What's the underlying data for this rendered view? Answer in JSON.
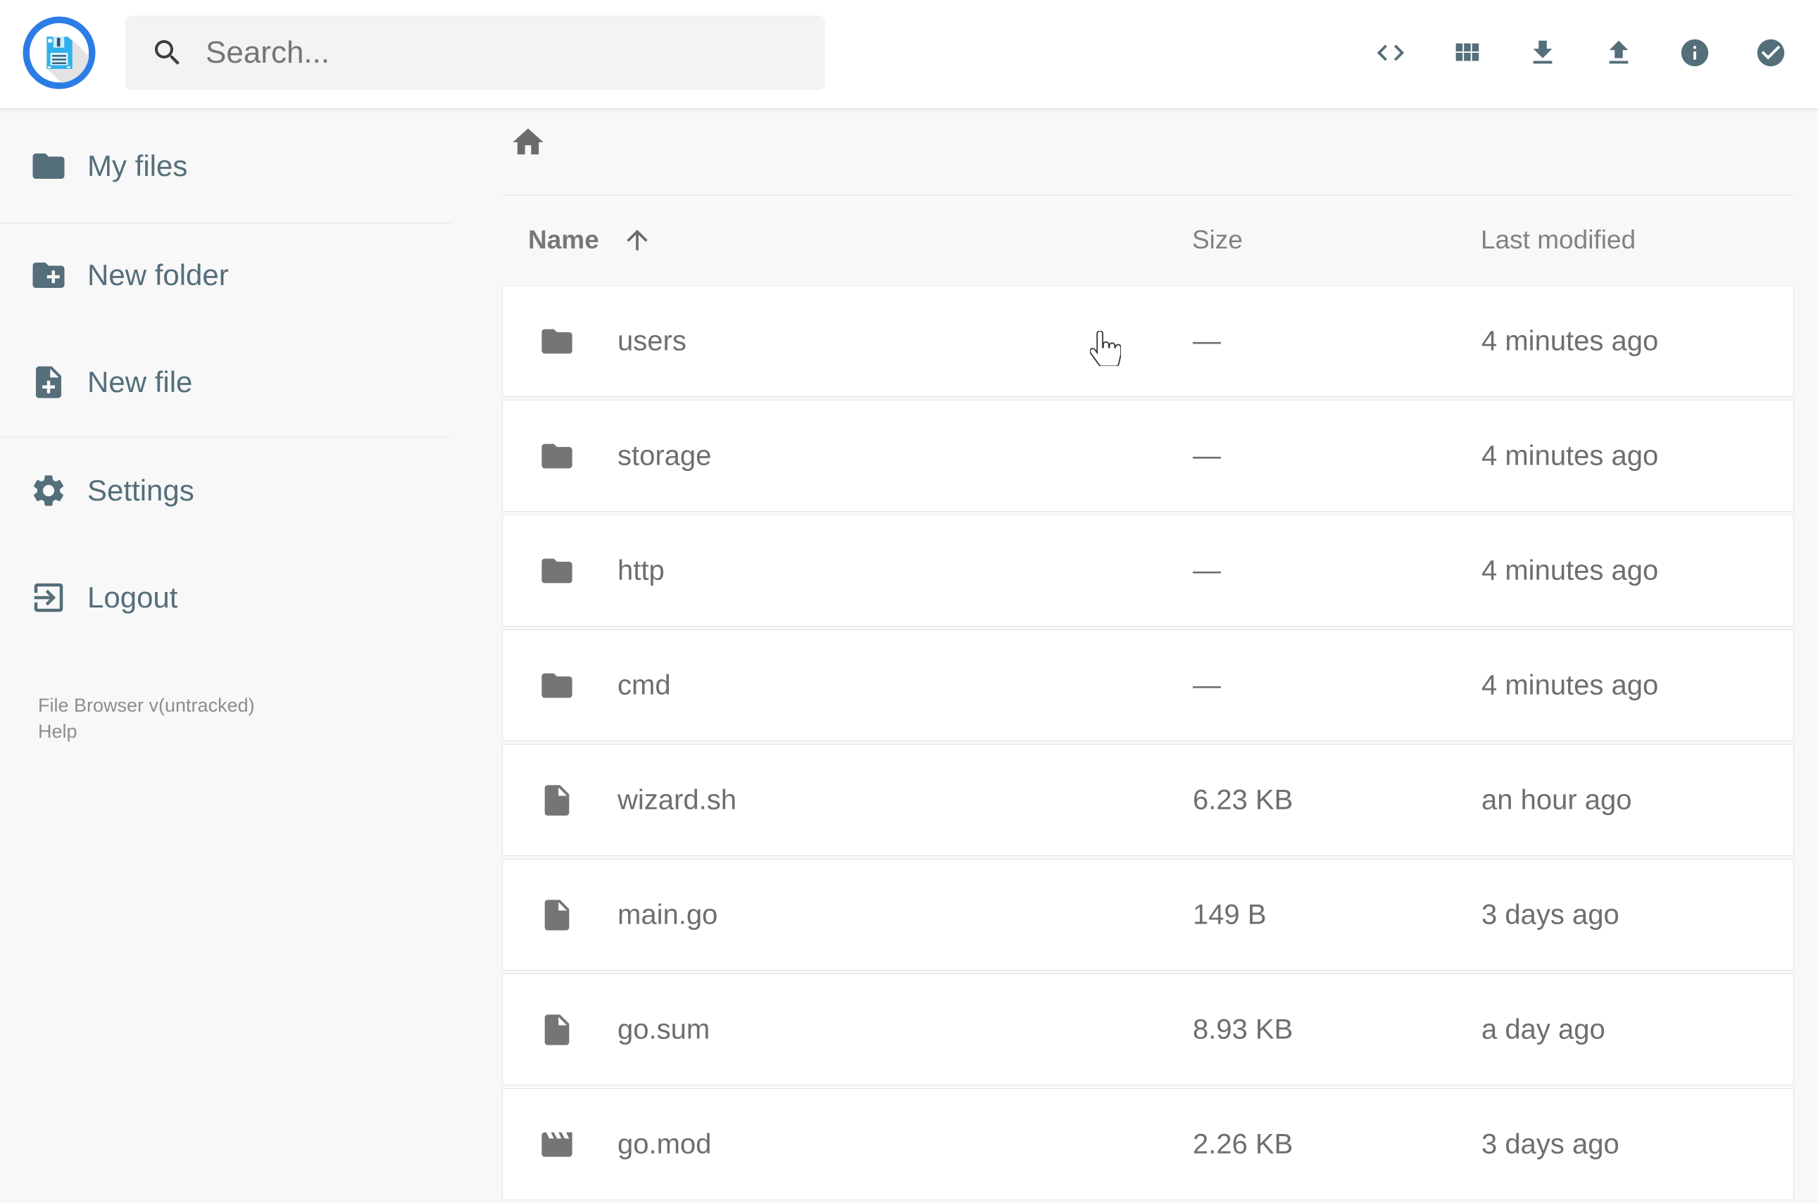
{
  "header": {
    "logo_title": "File Browser",
    "search": {
      "placeholder": "Search..."
    },
    "actions": [
      {
        "name": "open-shell"
      },
      {
        "name": "switch-view"
      },
      {
        "name": "download"
      },
      {
        "name": "upload"
      },
      {
        "name": "info"
      },
      {
        "name": "select-multiple"
      }
    ]
  },
  "sidebar": {
    "items": [
      {
        "label": "My files"
      },
      {
        "label": "New folder"
      },
      {
        "label": "New file"
      },
      {
        "label": "Settings"
      },
      {
        "label": "Logout"
      }
    ],
    "footer": {
      "version": "File Browser v(untracked)",
      "help": "Help"
    }
  },
  "listing": {
    "columns": {
      "name": "Name",
      "size": "Size",
      "modified": "Last modified"
    },
    "sort": {
      "column": "Name",
      "direction": "ascending"
    },
    "items": [
      {
        "name": "users",
        "type": "folder",
        "size": "—",
        "modified": "4 minutes ago"
      },
      {
        "name": "storage",
        "type": "folder",
        "size": "—",
        "modified": "4 minutes ago"
      },
      {
        "name": "http",
        "type": "folder",
        "size": "—",
        "modified": "4 minutes ago"
      },
      {
        "name": "cmd",
        "type": "folder",
        "size": "—",
        "modified": "4 minutes ago"
      },
      {
        "name": "wizard.sh",
        "type": "file",
        "size": "6.23 KB",
        "modified": "an hour ago"
      },
      {
        "name": "main.go",
        "type": "file",
        "size": "149 B",
        "modified": "3 days ago"
      },
      {
        "name": "go.sum",
        "type": "file",
        "size": "8.93 KB",
        "modified": "a day ago"
      },
      {
        "name": "go.mod",
        "type": "movie",
        "size": "2.26 KB",
        "modified": "3 days ago"
      }
    ]
  },
  "colors": {
    "accent_slate": "#546e7a",
    "logo_ring_blue": "#2c7ce5",
    "logo_floppy_blue": "#2fb1ec",
    "listing_icon_gray": "#757575",
    "listing_text_gray": "#6e6e6e",
    "page_background": "#f8f8f8"
  }
}
